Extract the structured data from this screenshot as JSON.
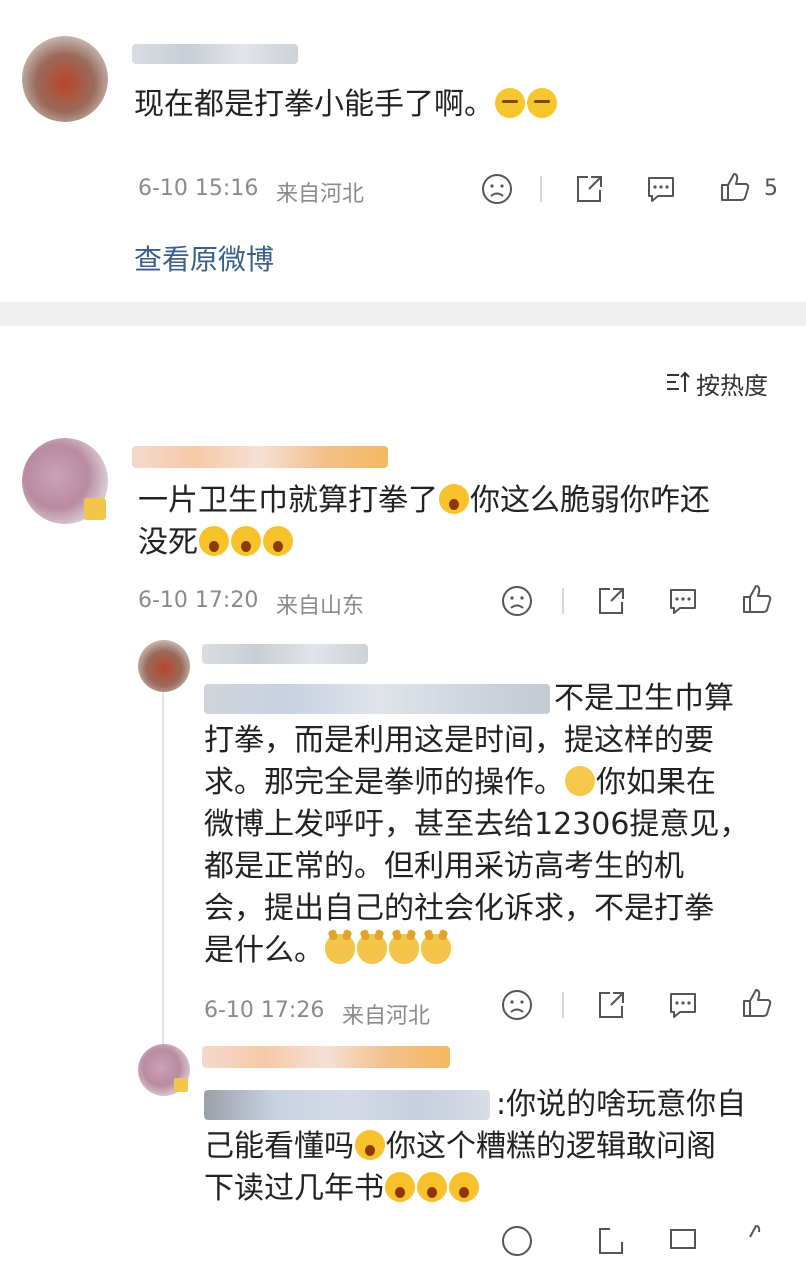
{
  "top_comment": {
    "text": "现在都是打拳小能手了啊。",
    "time": "6-10 15:16",
    "location": "来自河北",
    "likes": "5",
    "view_original": "查看原微博"
  },
  "sort_label": "按热度",
  "comments": [
    {
      "text": "一片卫生巾就算打拳了",
      "text2": "你这么脆弱你咋还",
      "text3": "没死",
      "time": "6-10 17:20",
      "location": "来自山东"
    }
  ],
  "replies": [
    {
      "line1": "不是卫生巾算",
      "line2": "打拳，而是利用这是时间，提这样的要",
      "line3": "求。那完全是拳师的操作。",
      "line3b": "你如果在",
      "line4": "微博上发呼吁，甚至去给12306提意见，",
      "line5": "都是正常的。但利用采访高考生的机",
      "line6": "会，提出自己的社会化诉求，不是打拳",
      "line7": "是什么。",
      "time": "6-10 17:26",
      "location": "来自河北"
    },
    {
      "line1": ":你说的啥玩意你自",
      "line2": "己能看懂吗",
      "line2b": "你这个糟糕的逻辑敢问阁",
      "line3": "下读过几年书"
    }
  ],
  "icons": {
    "dislike": "sad-face-icon",
    "share": "share-icon",
    "comment": "comment-bubble-icon",
    "like": "thumbs-up-icon",
    "sort": "sort-icon"
  },
  "colors": {
    "link": "#3c5f8a",
    "meta": "#8a8a8a",
    "band": "#f0f0f0"
  }
}
